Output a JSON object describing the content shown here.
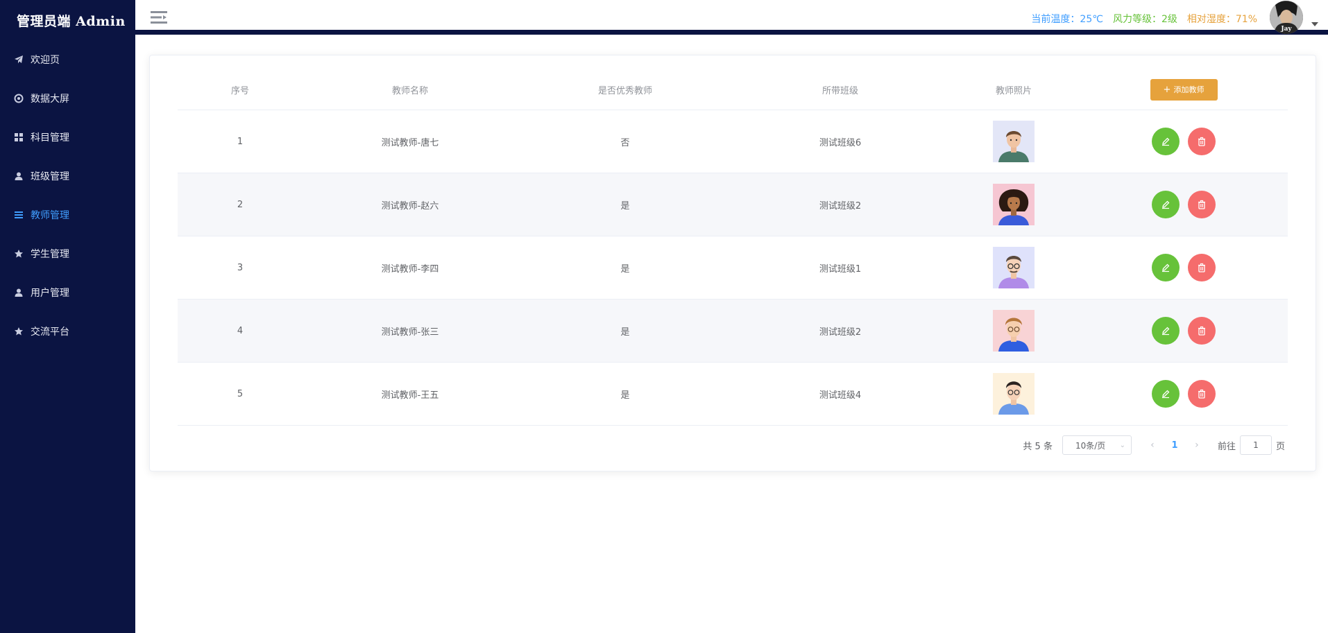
{
  "brand": "管理员端 Admin",
  "menu": [
    {
      "label": "欢迎页",
      "icon": "paper-plane-icon"
    },
    {
      "label": "数据大屏",
      "icon": "target-icon"
    },
    {
      "label": "科目管理",
      "icon": "grid-icon"
    },
    {
      "label": "班级管理",
      "icon": "user-icon"
    },
    {
      "label": "教师管理",
      "icon": "list-icon",
      "active": true
    },
    {
      "label": "学生管理",
      "icon": "star-icon"
    },
    {
      "label": "用户管理",
      "icon": "user-icon"
    },
    {
      "label": "交流平台",
      "icon": "star-icon"
    }
  ],
  "header": {
    "temperature": "当前温度：25℃",
    "wind": "风力等级：2级",
    "humidity": "相对湿度：71%",
    "avatar_text": "Jay"
  },
  "table": {
    "columns": [
      "序号",
      "教师名称",
      "是否优秀教师",
      "所带班级",
      "教师照片"
    ],
    "add_button": "添加教师",
    "rows": [
      {
        "index": "1",
        "name": "测试教师-唐七",
        "excellent": "否",
        "class": "测试班级6"
      },
      {
        "index": "2",
        "name": "测试教师-赵六",
        "excellent": "是",
        "class": "测试班级2"
      },
      {
        "index": "3",
        "name": "测试教师-李四",
        "excellent": "是",
        "class": "测试班级1"
      },
      {
        "index": "4",
        "name": "测试教师-张三",
        "excellent": "是",
        "class": "测试班级2"
      },
      {
        "index": "5",
        "name": "测试教师-王五",
        "excellent": "是",
        "class": "测试班级4"
      }
    ]
  },
  "pagination": {
    "total": "共 5 条",
    "page_size": "10条/页",
    "current_page": "1",
    "goto_label": "前往",
    "goto_value": "1",
    "page_suffix": "页"
  },
  "colors": {
    "sidebar_bg": "#0b1442",
    "active": "#409eff",
    "add_button": "#e6a23c",
    "edit_button": "#67c23a",
    "delete_button": "#f56c6c"
  }
}
